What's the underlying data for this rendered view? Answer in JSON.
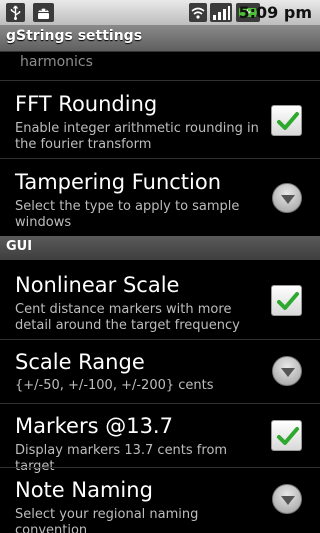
{
  "status_bar": {
    "time": "5:09 pm",
    "icons": [
      "usb-icon",
      "android-debug-icon",
      "wifi-icon",
      "signal-icon",
      "battery-charging-icon"
    ]
  },
  "app": {
    "title": "gStrings settings"
  },
  "list": {
    "partial_item": "harmonics",
    "items": [
      {
        "title": "FFT Rounding",
        "summary": "Enable integer arithmetic rounding in the fourier transform",
        "widget": "checkbox",
        "checked": true
      },
      {
        "title": "Tampering Function",
        "summary": "Select the type to apply to sample windows",
        "widget": "dropdown"
      }
    ],
    "category": "GUI",
    "gui_items": [
      {
        "title": "Nonlinear Scale",
        "summary": "Cent distance markers with more detail around the target frequency",
        "widget": "checkbox",
        "checked": true
      },
      {
        "title": "Scale Range",
        "summary": "{+/-50, +/-100, +/-200} cents",
        "widget": "dropdown"
      },
      {
        "title": "Markers @13.7",
        "summary": "Display markers 13.7 cents from target",
        "widget": "checkbox",
        "checked": true
      },
      {
        "title": "Note Naming",
        "summary": "Select your regional naming convention",
        "widget": "dropdown"
      }
    ]
  },
  "colors": {
    "check": "#2ea82e",
    "category_bg": "#4a4a4a",
    "summary_text": "#bdbdbd"
  }
}
